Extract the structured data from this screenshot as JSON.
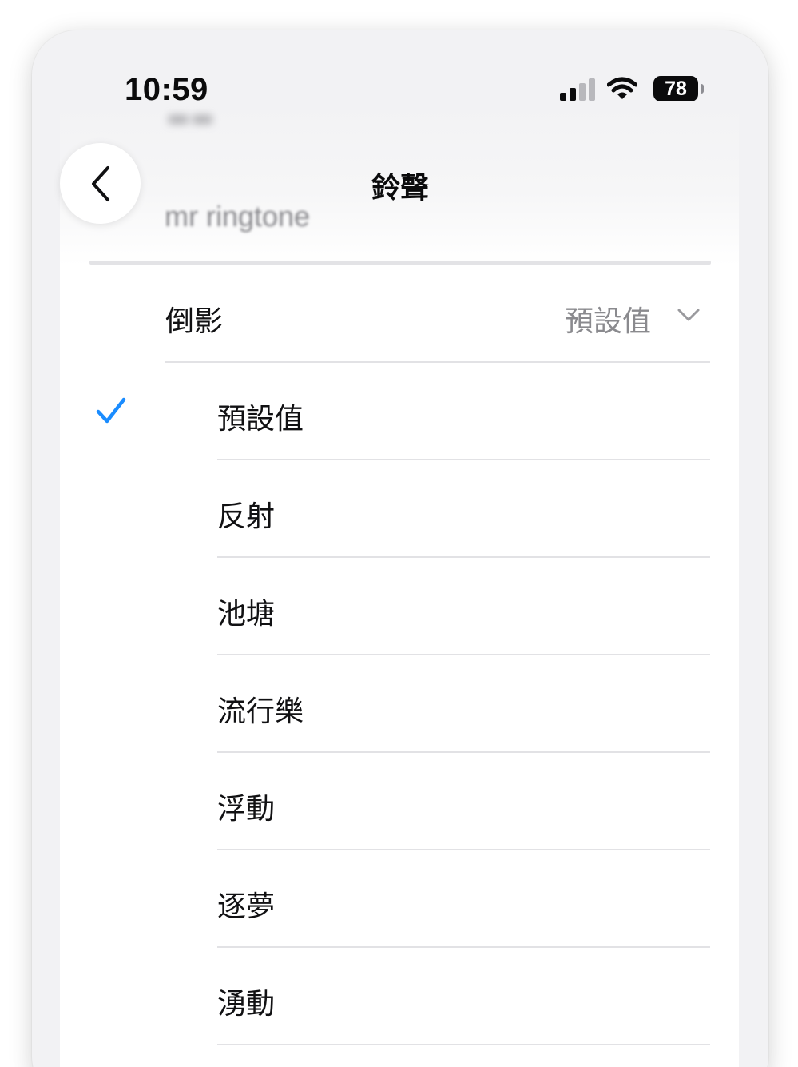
{
  "status_bar": {
    "time": "10:59",
    "battery_level": "78",
    "signal_bars_active": 2,
    "signal_bars_total": 4,
    "icons": [
      "cellular-signal-icon",
      "wifi-icon",
      "battery-icon"
    ]
  },
  "header": {
    "back_icon": "chevron-left-icon",
    "title": "鈴聲",
    "background_text": "mr ringtone"
  },
  "reflection": {
    "label": "倒影",
    "value": "預設值",
    "icon": "chevron-down-icon"
  },
  "tones": [
    {
      "label": "預設值",
      "selected": true
    },
    {
      "label": "反射",
      "selected": false
    },
    {
      "label": "池塘",
      "selected": false
    },
    {
      "label": "流行樂",
      "selected": false
    },
    {
      "label": "浮動",
      "selected": false
    },
    {
      "label": "逐夢",
      "selected": false
    },
    {
      "label": "湧動",
      "selected": false
    }
  ],
  "colors": {
    "accent": "#1a8cff",
    "text_primary": "#111113",
    "text_secondary": "#8a8a8e",
    "divider": "#e2e2e5",
    "background": "#f2f2f4"
  }
}
